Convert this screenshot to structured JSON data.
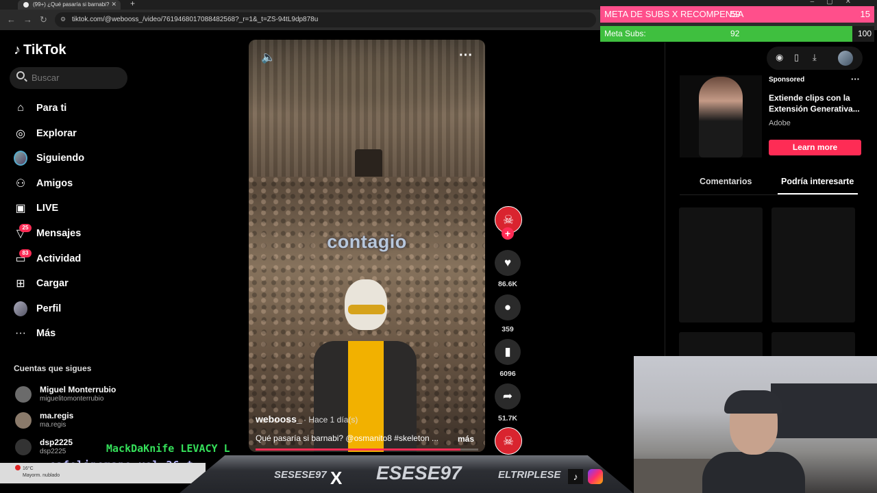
{
  "browser": {
    "tab_title": "(99+) ¿Qué pasaría si barnabi?",
    "url": "tiktok.com/@webooss_/video/7619468017088482568?_r=1&_t=ZS-94tL9dp878u"
  },
  "subs_overlay": {
    "goal_label": "META DE SUBS X RECOMPENSA",
    "goal_current": "59",
    "goal_target": "15",
    "meta_label": "Meta Subs:",
    "meta_current": "92",
    "meta_target": "100",
    "meta_fraction": 0.92
  },
  "sidebar": {
    "logo": "TikTok",
    "search_placeholder": "Buscar",
    "items": [
      {
        "label": "Para ti",
        "icon": "home-icon"
      },
      {
        "label": "Explorar",
        "icon": "compass-icon"
      },
      {
        "label": "Siguiendo",
        "icon": "avatar"
      },
      {
        "label": "Amigos",
        "icon": "friends-icon"
      },
      {
        "label": "LIVE",
        "icon": "live-icon"
      },
      {
        "label": "Mensajes",
        "icon": "messages-icon",
        "badge": "25"
      },
      {
        "label": "Actividad",
        "icon": "activity-icon",
        "badge": "83"
      },
      {
        "label": "Cargar",
        "icon": "upload-icon"
      },
      {
        "label": "Perfil",
        "icon": "avatar"
      },
      {
        "label": "Más",
        "icon": "more-icon"
      }
    ],
    "following_title": "Cuentas que sigues",
    "following": [
      {
        "name": "Miguel Monterrubio",
        "handle": "miguelitomonterrubio"
      },
      {
        "name": "ma.regis",
        "handle": "ma.regis"
      },
      {
        "name": "dsp2225",
        "handle": "dsp2225"
      }
    ]
  },
  "video": {
    "overlay_text": "contagio",
    "author": "webooss_",
    "time": "· Hace 1 día(s)",
    "description": "Qué pasaría si barnabi? @osmanito8 #skeleton ...",
    "more_label": "más",
    "progress_fraction": 0.92
  },
  "actions": {
    "likes": "86.6K",
    "comments": "359",
    "saves": "6096",
    "shares": "51.7K"
  },
  "ad": {
    "sponsored_label": "Sponsored",
    "title": "Extiende clips con la Extensión Generativa...",
    "brand": "Adobe",
    "cta": "Learn more"
  },
  "right_tabs": {
    "comments": "Comentarios",
    "suggested": "Podría interesarte"
  },
  "stream": {
    "chat_names": "MackDaKnife  LEVACY  L",
    "chat_line2": "cafelinomano  vel 26  t",
    "weather_temp": "16°C",
    "weather_desc": "Mayorm. nublado",
    "banner_left": "SESESE97",
    "banner_center": "ESESE97",
    "banner_right": "ELTRIPLESE"
  },
  "colors": {
    "tiktok_red": "#fe2c55",
    "subs_pink": "#ff4f8b",
    "subs_green": "#3fbf3f",
    "chat_green": "#35e05a"
  }
}
